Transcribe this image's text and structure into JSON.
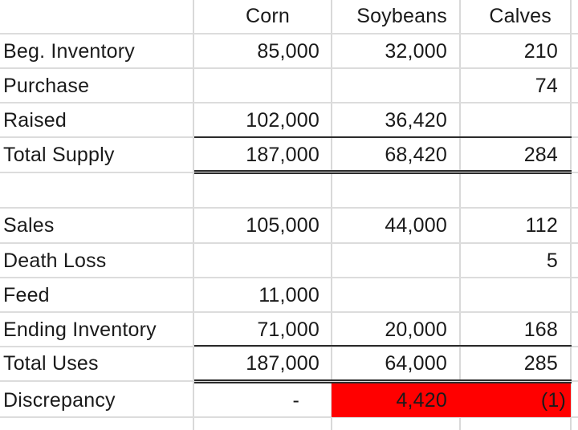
{
  "sheet": {
    "columns": [
      "",
      "Corn",
      "Soybeans",
      "Calves"
    ],
    "rows": [
      {
        "label": "Beg. Inventory",
        "corn": "85,000",
        "soybeans": "32,000",
        "calves": "210"
      },
      {
        "label": "Purchase",
        "corn": "",
        "soybeans": "",
        "calves": "74"
      },
      {
        "label": "Raised",
        "corn": "102,000",
        "soybeans": "36,420",
        "calves": ""
      },
      {
        "label": "Total Supply",
        "corn": "187,000",
        "soybeans": "68,420",
        "calves": "284"
      },
      {
        "label": "",
        "corn": "",
        "soybeans": "",
        "calves": ""
      },
      {
        "label": "Sales",
        "corn": "105,000",
        "soybeans": "44,000",
        "calves": "112"
      },
      {
        "label": "Death Loss",
        "corn": "",
        "soybeans": "",
        "calves": "5"
      },
      {
        "label": "Feed",
        "corn": "11,000",
        "soybeans": "",
        "calves": ""
      },
      {
        "label": "Ending Inventory",
        "corn": "71,000",
        "soybeans": "20,000",
        "calves": "168"
      },
      {
        "label": "Total Uses",
        "corn": "187,000",
        "soybeans": "64,000",
        "calves": "285"
      },
      {
        "label": "Discrepancy",
        "corn": "-",
        "soybeans": "4,420",
        "calves": "(1)"
      }
    ],
    "highlight_color": "#ff0000"
  }
}
